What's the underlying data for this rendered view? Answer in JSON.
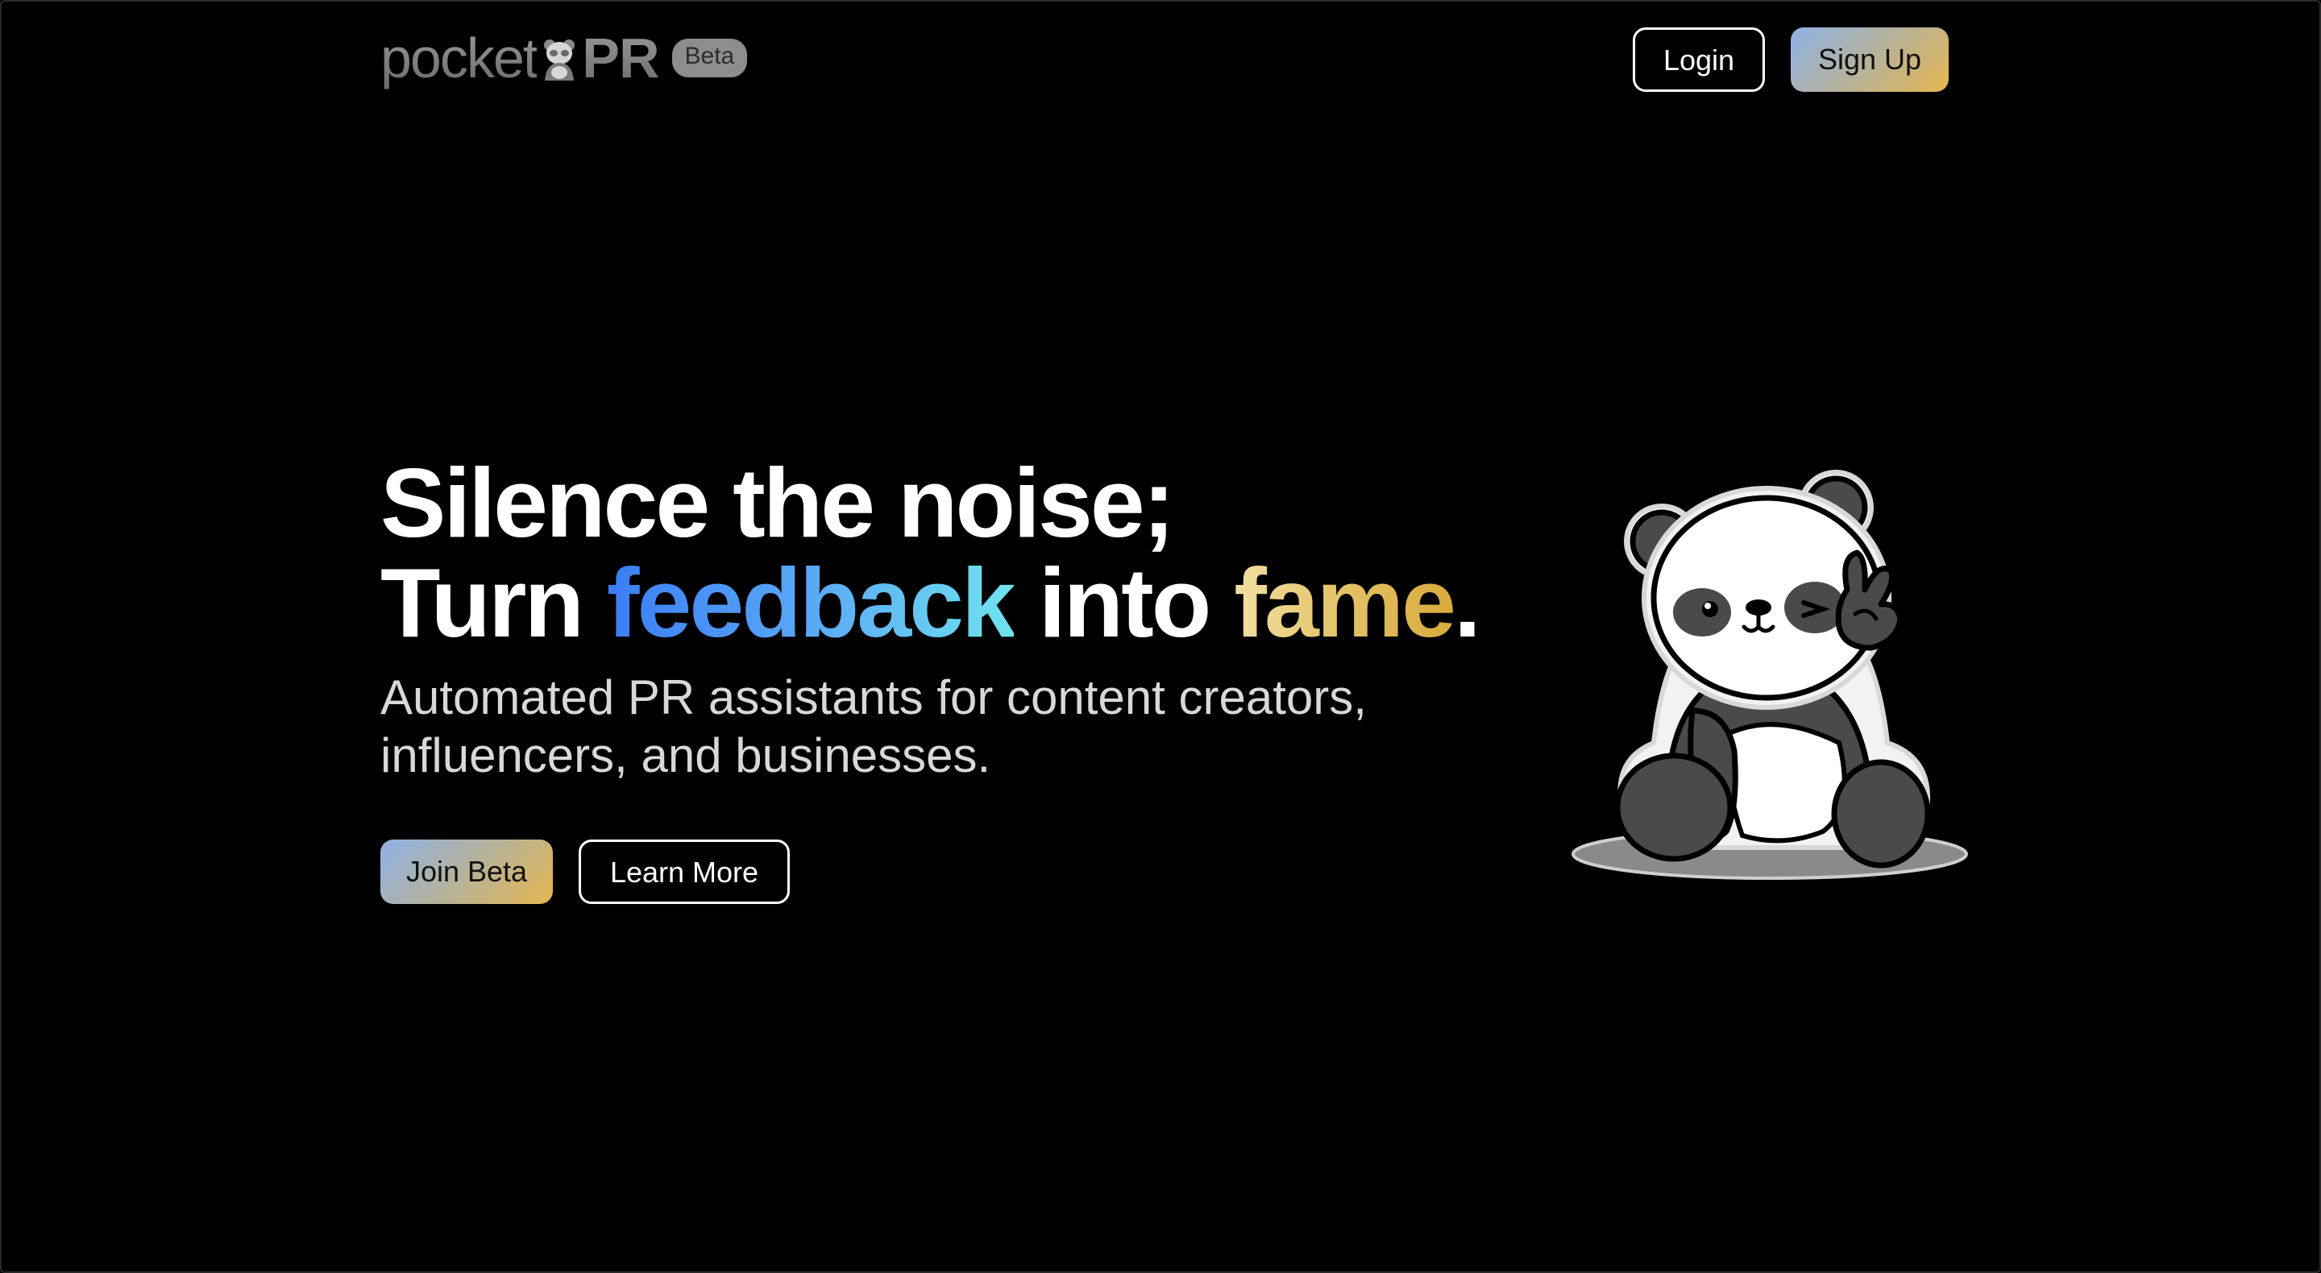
{
  "header": {
    "logo_left": "pocket",
    "logo_right": "PR",
    "beta_badge": "Beta",
    "login_label": "Login",
    "signup_label": "Sign Up"
  },
  "hero": {
    "line1": "Silence the noise;",
    "line2_a": "Turn ",
    "line2_highlight1": "feedback",
    "line2_b": " into ",
    "line2_highlight2": "fame",
    "line2_end": ".",
    "subhead_line1": "Automated PR assistants for content creators,",
    "subhead_line2": "influencers, and businesses.",
    "join_label": "Join Beta",
    "learn_label": "Learn More"
  },
  "icons": {
    "logo_mark": "panda-logo-icon",
    "mascot": "panda-mascot-illustration"
  },
  "colors": {
    "background": "#000000",
    "feedback_gradient": [
      "#3b7df5",
      "#6fe3ee"
    ],
    "fame_gradient": [
      "#f0e0a2",
      "#d9a93c"
    ],
    "cta_gradient": [
      "#8eb2e8",
      "#e5b650"
    ]
  }
}
